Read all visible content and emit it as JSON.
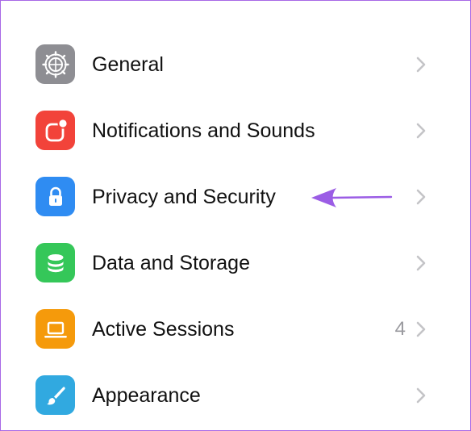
{
  "settings": {
    "items": [
      {
        "label": "General",
        "icon": "gear-icon",
        "color": "#8e8e93"
      },
      {
        "label": "Notifications and Sounds",
        "icon": "notification-icon",
        "color": "#f2433a"
      },
      {
        "label": "Privacy and Security",
        "icon": "lock-icon",
        "color": "#2f8cf2"
      },
      {
        "label": "Data and Storage",
        "icon": "database-icon",
        "color": "#35c759"
      },
      {
        "label": "Active Sessions",
        "icon": "laptop-icon",
        "count": "4",
        "color": "#f59a0b"
      },
      {
        "label": "Appearance",
        "icon": "brush-icon",
        "color": "#31a9e0"
      }
    ]
  },
  "annotation": {
    "icon": "arrow-left-icon",
    "color": "#9b5de5"
  }
}
